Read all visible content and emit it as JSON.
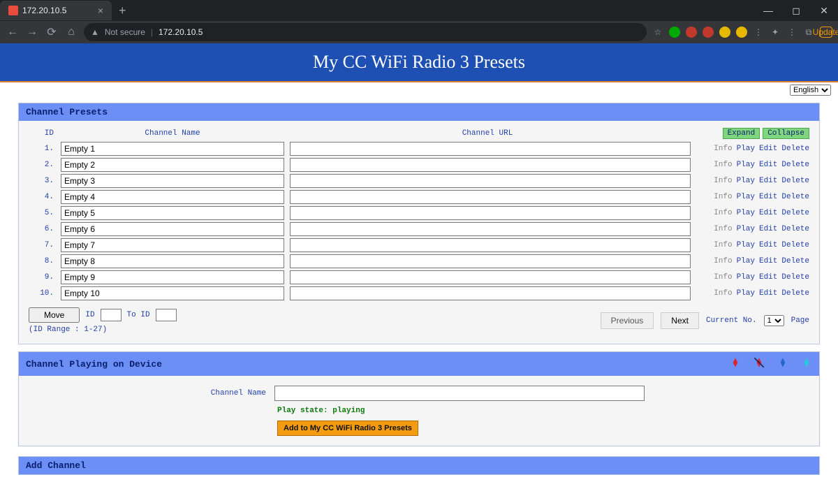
{
  "browser": {
    "tab_title": "172.20.10.5",
    "url": "172.20.10.5",
    "not_secure_label": "Not secure",
    "update_label": "Update"
  },
  "banner": {
    "title": "My CC WiFi Radio 3 Presets"
  },
  "language": {
    "selected": "English"
  },
  "presets_panel": {
    "title": "Channel Presets",
    "columns": {
      "id": "ID",
      "name": "Channel Name",
      "url": "Channel URL"
    },
    "expand_label": "Expand",
    "collapse_label": "Collapse",
    "rows": [
      {
        "id": "1.",
        "name": "Empty 1",
        "url": ""
      },
      {
        "id": "2.",
        "name": "Empty 2",
        "url": ""
      },
      {
        "id": "3.",
        "name": "Empty 3",
        "url": ""
      },
      {
        "id": "4.",
        "name": "Empty 4",
        "url": ""
      },
      {
        "id": "5.",
        "name": "Empty 5",
        "url": ""
      },
      {
        "id": "6.",
        "name": "Empty 6",
        "url": ""
      },
      {
        "id": "7.",
        "name": "Empty 7",
        "url": ""
      },
      {
        "id": "8.",
        "name": "Empty 8",
        "url": ""
      },
      {
        "id": "9.",
        "name": "Empty 9",
        "url": ""
      },
      {
        "id": "10.",
        "name": "Empty 10",
        "url": ""
      }
    ],
    "action_labels": {
      "info": "Info",
      "play": "Play",
      "edit": "Edit",
      "delete": "Delete"
    },
    "move": {
      "button": "Move",
      "id_label": "ID",
      "to_label": "To ID",
      "range_note": "(ID Range : 1-27)"
    },
    "paging": {
      "previous": "Previous",
      "next": "Next",
      "current_label": "Current No.",
      "selected": "1",
      "page_suffix": "Page"
    }
  },
  "playing_panel": {
    "title": "Channel Playing on Device",
    "channel_name_label": "Channel Name",
    "channel_name_value": "",
    "play_state": "Play state: playing",
    "add_button": "Add to My CC WiFi Radio 3 Presets"
  },
  "add_panel": {
    "title": "Add Channel"
  }
}
